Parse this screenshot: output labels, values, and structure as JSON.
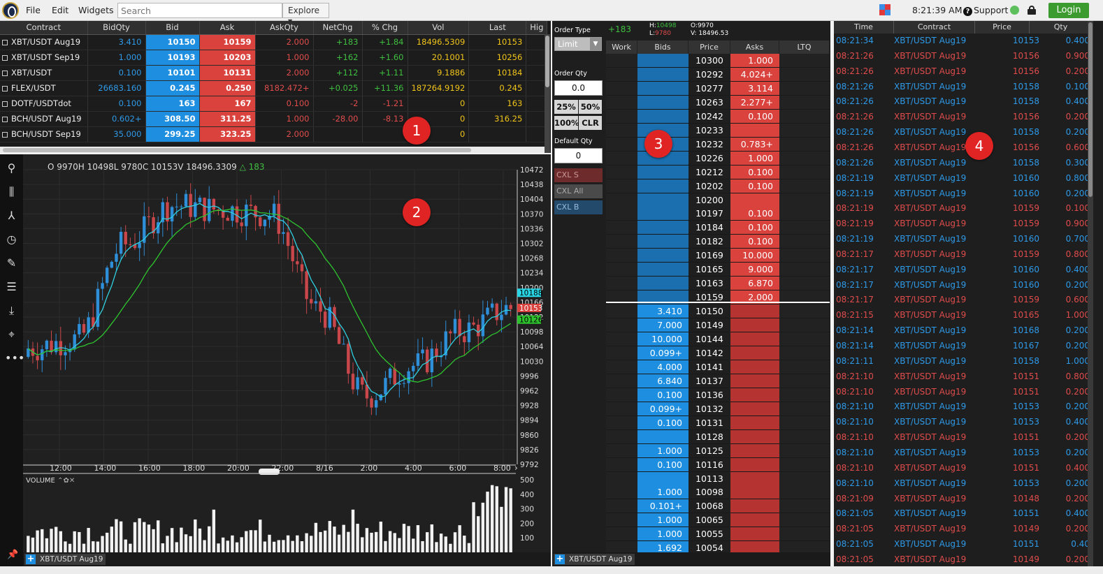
{
  "menu": {
    "file": "File",
    "edit": "Edit",
    "widgets": "Widgets"
  },
  "search": {
    "placeholder": "Search"
  },
  "explore": {
    "label": "Explore"
  },
  "clock": {
    "time": "8:21:39 AM"
  },
  "support": {
    "label": "Support"
  },
  "login": {
    "label": "Login"
  },
  "market_table": {
    "columns": [
      "Contract",
      "BidQty",
      "Bid",
      "Ask",
      "AskQty",
      "NetChg",
      "% Chg",
      "Vol",
      "Last",
      "Hig"
    ],
    "rows": [
      {
        "contract": "XBT/USDT Aug19",
        "bidqty": "3.410",
        "bid": "10150",
        "ask": "10159",
        "askqty": "2.000",
        "netchg": "+183",
        "pchg": "+1.84",
        "vol": "18496.5309",
        "last": "10153"
      },
      {
        "contract": "XBT/USDT Sep19",
        "bidqty": "1.000",
        "bid": "10193",
        "ask": "10203",
        "askqty": "1.000",
        "netchg": "+162",
        "pchg": "+1.60",
        "vol": "20.1001",
        "last": "10256"
      },
      {
        "contract": "XBT/USDT",
        "bidqty": "0.100",
        "bid": "10101",
        "ask": "10131",
        "askqty": "2.000",
        "netchg": "+112",
        "pchg": "+1.11",
        "vol": "9.1886",
        "last": "10184"
      },
      {
        "contract": "FLEX/USDT",
        "bidqty": "26683.160",
        "bid": "0.245",
        "ask": "0.250",
        "askqty": "8182.472+",
        "netchg": "+0.025",
        "pchg": "+11.36",
        "vol": "187264.9192",
        "last": "0.245"
      },
      {
        "contract": "DOTF/USDTdot",
        "bidqty": "0.100",
        "bid": "163",
        "ask": "167",
        "askqty": "0.100",
        "netchg": "-2",
        "pchg": "-1.21",
        "vol": "0",
        "last": "163"
      },
      {
        "contract": "BCH/USDT Aug19",
        "bidqty": "0.602+",
        "bid": "308.50",
        "ask": "311.25",
        "askqty": "1.000",
        "netchg": "-28.00",
        "pchg": "-8.13",
        "vol": "0",
        "last": "316.25"
      },
      {
        "contract": "BCH/USDT Sep19",
        "bidqty": "35.000",
        "bid": "299.25",
        "ask": "323.25",
        "askqty": "2.000",
        "netchg": "",
        "pchg": "",
        "vol": "0",
        "last": ""
      }
    ]
  },
  "chart": {
    "info": "O 9970H 10498L 9780C 10153V 18496.3309",
    "change": "△ 183",
    "volume_label": "VOLUME",
    "tab_label": "XBT/USDT Aug19",
    "price_axis": [
      "10472",
      "10438",
      "10404",
      "10370",
      "10336",
      "10302",
      "10268",
      "10234",
      "10200",
      "10166",
      "10132",
      "10098",
      "10064",
      "10030",
      "9996",
      "9962",
      "9928",
      "9894",
      "9860",
      "9826",
      "9792"
    ],
    "time_axis": [
      "12:00",
      "14:00",
      "16:00",
      "18:00",
      "20:00",
      "22:00",
      "8/16",
      "2:00",
      "4:00",
      "6:00",
      "8:00"
    ],
    "vol_axis": [
      "500",
      "400",
      "300",
      "200",
      "100"
    ],
    "markers": {
      "cyan": "10188",
      "red": "10153",
      "green": "10126"
    },
    "colors": {
      "up": "#2e8fd8",
      "down": "#c9474a",
      "ma_fast": "#2fd0e0",
      "ma_slow": "#2ec42e"
    }
  },
  "chart_data": {
    "type": "line",
    "x": [
      "12:00",
      "14:00",
      "16:00",
      "18:00",
      "20:00",
      "22:00",
      "8/16",
      "2:00",
      "4:00",
      "6:00",
      "8:00"
    ],
    "series": [
      {
        "values": [
          10060,
          10080,
          10300,
          10390,
          10380,
          10370,
          10150,
          9950,
          10020,
          10100,
          10153
        ]
      }
    ],
    "ylim": [
      9792,
      10472
    ]
  },
  "order_ticket": {
    "order_type_label": "Order Type",
    "order_type": "Limit",
    "order_qty_label": "Order Qty",
    "order_qty": "0.0",
    "pct": [
      "25%",
      "50%",
      "100%",
      "CLR"
    ],
    "default_qty_label": "Default Qty",
    "default_qty": "0",
    "cxl": [
      "CXL S",
      "CXL All",
      "CXL B"
    ]
  },
  "dom": {
    "change": "+183",
    "high_label": "H:",
    "high": "10498",
    "low_label": "L:",
    "low": "9780",
    "open": "O:9970",
    "volume": "V: 18496.53",
    "columns": [
      "Work",
      "Bids",
      "Price",
      "Asks",
      "LTQ"
    ],
    "tab_label": "XBT/USDT Aug19",
    "rows": [
      {
        "price": "10300",
        "bid": "",
        "ask": "1.000"
      },
      {
        "price": "10292",
        "bid": "",
        "ask": "4.024+"
      },
      {
        "price": "10277",
        "bid": "",
        "ask": "3.114"
      },
      {
        "price": "10263",
        "bid": "",
        "ask": "2.277+"
      },
      {
        "price": "10242",
        "bid": "",
        "ask": "0.100"
      },
      {
        "price": "10233",
        "bid": "",
        "ask": ""
      },
      {
        "price": "10232",
        "bid": "",
        "ask": "0.783+"
      },
      {
        "price": "10226",
        "bid": "",
        "ask": "1.000"
      },
      {
        "price": "10212",
        "bid": "",
        "ask": "0.100"
      },
      {
        "price": "10202",
        "bid": "",
        "ask": "0.100"
      },
      {
        "price": "10200",
        "bid": "",
        "ask": ""
      },
      {
        "price": "10197",
        "bid": "",
        "ask": "0.100"
      },
      {
        "price": "10184",
        "bid": "",
        "ask": "0.100"
      },
      {
        "price": "10182",
        "bid": "",
        "ask": "0.100"
      },
      {
        "price": "10169",
        "bid": "",
        "ask": "10.000"
      },
      {
        "price": "10165",
        "bid": "",
        "ask": "9.000"
      },
      {
        "price": "10163",
        "bid": "",
        "ask": "6.870"
      },
      {
        "price": "10159",
        "bid": "",
        "ask": "2.000"
      },
      {
        "price": "10150",
        "bid": "3.410",
        "ask": ""
      },
      {
        "price": "10149",
        "bid": "7.000",
        "ask": ""
      },
      {
        "price": "10144",
        "bid": "10.000",
        "ask": ""
      },
      {
        "price": "10142",
        "bid": "0.099+",
        "ask": ""
      },
      {
        "price": "10141",
        "bid": "4.000",
        "ask": ""
      },
      {
        "price": "10137",
        "bid": "6.840",
        "ask": ""
      },
      {
        "price": "10136",
        "bid": "0.100",
        "ask": ""
      },
      {
        "price": "10132",
        "bid": "0.099+",
        "ask": ""
      },
      {
        "price": "10131",
        "bid": "0.100",
        "ask": ""
      },
      {
        "price": "10128",
        "bid": "",
        "ask": ""
      },
      {
        "price": "10125",
        "bid": "1.000",
        "ask": ""
      },
      {
        "price": "10116",
        "bid": "0.100",
        "ask": ""
      },
      {
        "price": "10113",
        "bid": "",
        "ask": ""
      },
      {
        "price": "10098",
        "bid": "1.000",
        "ask": ""
      },
      {
        "price": "10068",
        "bid": "0.101+",
        "ask": ""
      },
      {
        "price": "10065",
        "bid": "1.000",
        "ask": ""
      },
      {
        "price": "10055",
        "bid": "1.000",
        "ask": ""
      },
      {
        "price": "10054",
        "bid": "1.692",
        "ask": ""
      }
    ]
  },
  "trades": {
    "columns": [
      "Time",
      "Contract",
      "Price",
      "Qty"
    ],
    "rows": [
      {
        "time": "08:21:34",
        "contract": "XBT/USDT Aug19",
        "price": "10153",
        "qty": "0.400",
        "side": "buy"
      },
      {
        "time": "08:21:26",
        "contract": "XBT/USDT Aug19",
        "price": "10156",
        "qty": "0.900",
        "side": "sell"
      },
      {
        "time": "08:21:26",
        "contract": "XBT/USDT Aug19",
        "price": "10156",
        "qty": "0.200",
        "side": "sell"
      },
      {
        "time": "08:21:26",
        "contract": "XBT/USDT Aug19",
        "price": "10158",
        "qty": "0.100",
        "side": "buy"
      },
      {
        "time": "08:21:26",
        "contract": "XBT/USDT Aug19",
        "price": "10158",
        "qty": "0.400",
        "side": "buy"
      },
      {
        "time": "08:21:26",
        "contract": "XBT/USDT Aug19",
        "price": "10156",
        "qty": "0.200",
        "side": "sell"
      },
      {
        "time": "08:21:26",
        "contract": "XBT/USDT Aug19",
        "price": "10158",
        "qty": "0.200",
        "side": "buy"
      },
      {
        "time": "08:21:26",
        "contract": "XBT/USDT Aug19",
        "price": "10156",
        "qty": "0.600",
        "side": "sell"
      },
      {
        "time": "08:21:26",
        "contract": "XBT/USDT Aug19",
        "price": "10158",
        "qty": "0.300",
        "side": "buy"
      },
      {
        "time": "08:21:19",
        "contract": "XBT/USDT Aug19",
        "price": "10160",
        "qty": "0.800",
        "side": "buy"
      },
      {
        "time": "08:21:19",
        "contract": "XBT/USDT Aug19",
        "price": "10160",
        "qty": "0.200",
        "side": "buy"
      },
      {
        "time": "08:21:19",
        "contract": "XBT/USDT Aug19",
        "price": "10159",
        "qty": "0.100",
        "side": "sell"
      },
      {
        "time": "08:21:19",
        "contract": "XBT/USDT Aug19",
        "price": "10159",
        "qty": "0.900",
        "side": "sell"
      },
      {
        "time": "08:21:19",
        "contract": "XBT/USDT Aug19",
        "price": "10160",
        "qty": "0.700",
        "side": "buy"
      },
      {
        "time": "08:21:17",
        "contract": "XBT/USDT Aug19",
        "price": "10159",
        "qty": "0.800",
        "side": "sell"
      },
      {
        "time": "08:21:17",
        "contract": "XBT/USDT Aug19",
        "price": "10160",
        "qty": "0.400",
        "side": "buy"
      },
      {
        "time": "08:21:17",
        "contract": "XBT/USDT Aug19",
        "price": "10160",
        "qty": "0.200",
        "side": "buy"
      },
      {
        "time": "08:21:17",
        "contract": "XBT/USDT Aug19",
        "price": "10159",
        "qty": "0.600",
        "side": "sell"
      },
      {
        "time": "08:21:15",
        "contract": "XBT/USDT Aug19",
        "price": "10165",
        "qty": "1.000",
        "side": "sell"
      },
      {
        "time": "08:21:14",
        "contract": "XBT/USDT Aug19",
        "price": "10168",
        "qty": "0.200",
        "side": "buy"
      },
      {
        "time": "08:21:14",
        "contract": "XBT/USDT Aug19",
        "price": "10167",
        "qty": "0.200",
        "side": "buy"
      },
      {
        "time": "08:21:11",
        "contract": "XBT/USDT Aug19",
        "price": "10158",
        "qty": "1.000",
        "side": "buy"
      },
      {
        "time": "08:21:10",
        "contract": "XBT/USDT Aug19",
        "price": "10151",
        "qty": "0.800",
        "side": "sell"
      },
      {
        "time": "08:21:10",
        "contract": "XBT/USDT Aug19",
        "price": "10151",
        "qty": "0.200",
        "side": "sell"
      },
      {
        "time": "08:21:10",
        "contract": "XBT/USDT Aug19",
        "price": "10153",
        "qty": "0.200",
        "side": "buy"
      },
      {
        "time": "08:21:10",
        "contract": "XBT/USDT Aug19",
        "price": "10153",
        "qty": "0.400",
        "side": "buy"
      },
      {
        "time": "08:21:10",
        "contract": "XBT/USDT Aug19",
        "price": "10151",
        "qty": "0.200",
        "side": "sell"
      },
      {
        "time": "08:21:10",
        "contract": "XBT/USDT Aug19",
        "price": "10153",
        "qty": "0.200",
        "side": "buy"
      },
      {
        "time": "08:21:10",
        "contract": "XBT/USDT Aug19",
        "price": "10151",
        "qty": "0.400",
        "side": "sell"
      },
      {
        "time": "08:21:10",
        "contract": "XBT/USDT Aug19",
        "price": "10153",
        "qty": "0.200",
        "side": "buy"
      },
      {
        "time": "08:21:09",
        "contract": "XBT/USDT Aug19",
        "price": "10148",
        "qty": "0.200",
        "side": "sell"
      },
      {
        "time": "08:21:05",
        "contract": "XBT/USDT Aug19",
        "price": "10151",
        "qty": "0.400",
        "side": "buy"
      },
      {
        "time": "08:21:05",
        "contract": "XBT/USDT Aug19",
        "price": "10149",
        "qty": "0.200",
        "side": "sell"
      },
      {
        "time": "08:21:05",
        "contract": "XBT/USDT Aug19",
        "price": "10151",
        "qty": "0.40",
        "side": "buy"
      },
      {
        "time": "08:21:05",
        "contract": "XBT/USDT Aug19",
        "price": "10149",
        "qty": "0.200",
        "side": "sell"
      }
    ]
  },
  "callouts": [
    "1",
    "2",
    "3",
    "4"
  ],
  "colors": {
    "bid": "#1e8fe0",
    "ask": "#d9423d",
    "login": "#3b9b2f"
  }
}
